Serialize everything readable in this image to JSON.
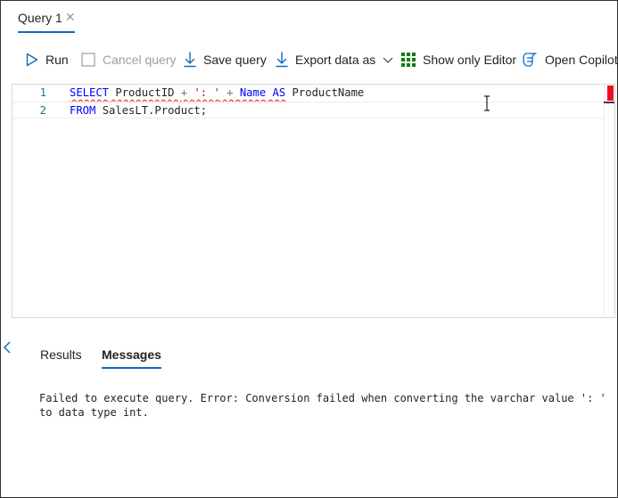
{
  "tabs": [
    {
      "label": "Query 1",
      "close_glyph": "✕"
    }
  ],
  "toolbar": {
    "run_label": "Run",
    "cancel_label": "Cancel query",
    "save_label": "Save query",
    "export_label": "Export data as",
    "show_editor_label": "Show only Editor",
    "copilot_label": "Open Copilot"
  },
  "editor": {
    "lines": [
      {
        "number": "1",
        "tokens": [
          {
            "text": "SELECT",
            "type": "keyword"
          },
          {
            "text": " ProductID ",
            "type": "identifier"
          },
          {
            "text": "+",
            "type": "operator"
          },
          {
            "text": " ",
            "type": "space"
          },
          {
            "text": "': '",
            "type": "string"
          },
          {
            "text": " ",
            "type": "space"
          },
          {
            "text": "+",
            "type": "operator"
          },
          {
            "text": " ",
            "type": "space"
          },
          {
            "text": "Name",
            "type": "keyword"
          },
          {
            "text": " ",
            "type": "space"
          },
          {
            "text": "AS",
            "type": "keyword"
          },
          {
            "text": " ProductName",
            "type": "identifier"
          }
        ]
      },
      {
        "number": "2",
        "tokens": [
          {
            "text": "FROM",
            "type": "keyword"
          },
          {
            "text": " SalesLT.Product;",
            "type": "identifier"
          }
        ]
      }
    ]
  },
  "results": {
    "tabs": [
      {
        "label": "Results",
        "active": false
      },
      {
        "label": "Messages",
        "active": true
      }
    ],
    "message": "Failed to execute query. Error: Conversion failed when converting the varchar value ': '\nto data type int."
  },
  "colors": {
    "accent": "#0f6cbd",
    "keyword": "#0000ff",
    "string": "#a31515",
    "error": "#e51400",
    "line_number": "#237893",
    "grid_icon": "#107c10"
  },
  "icons": {
    "run": "play-icon",
    "cancel": "checkbox-icon",
    "save": "arrow-down-icon",
    "export": "arrow-down-icon",
    "export_menu": "chevron-down-icon",
    "show_editor": "grid-icon",
    "copilot": "copilot-icon",
    "collapse": "chevron-left-icon"
  }
}
